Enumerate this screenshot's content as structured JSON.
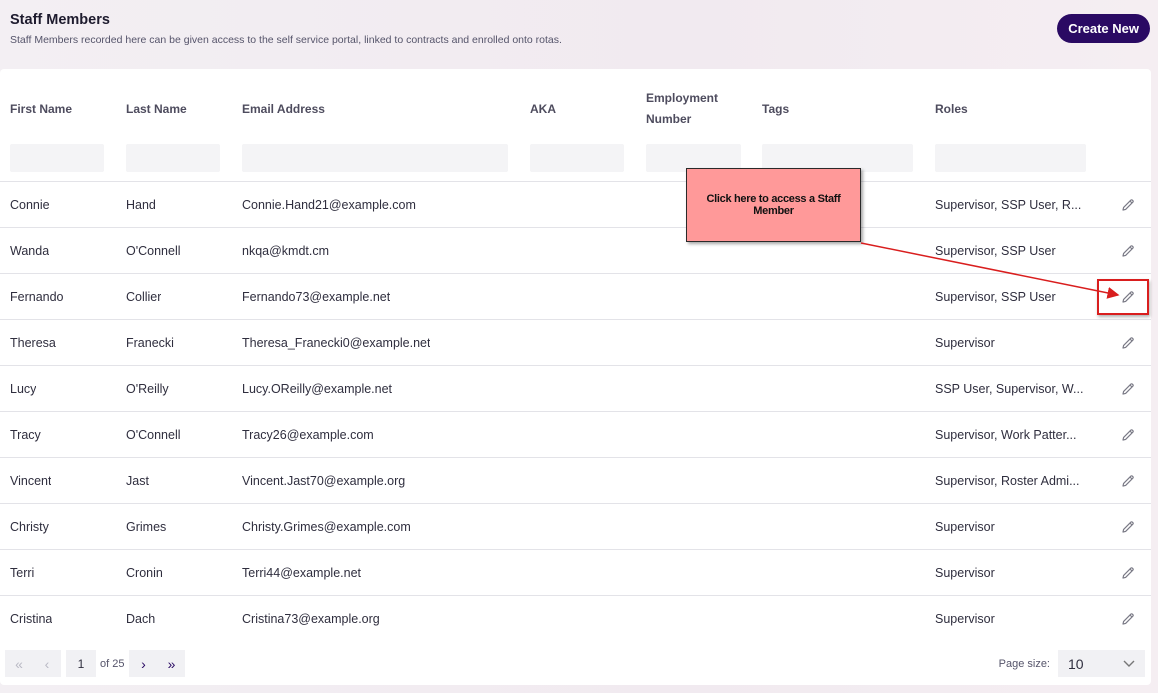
{
  "header": {
    "title": "Staff Members",
    "subtitle": "Staff Members recorded here can be given access to the self service portal, linked to contracts and enrolled onto rotas.",
    "create_button": "Create New"
  },
  "table": {
    "columns": [
      {
        "key": "first_name",
        "label": "First Name"
      },
      {
        "key": "last_name",
        "label": "Last Name"
      },
      {
        "key": "email",
        "label": "Email Address"
      },
      {
        "key": "aka",
        "label": "AKA"
      },
      {
        "key": "employment_number",
        "label": "Employment Number"
      },
      {
        "key": "tags",
        "label": "Tags"
      },
      {
        "key": "roles",
        "label": "Roles"
      }
    ],
    "rows": [
      {
        "first_name": "Connie",
        "last_name": "Hand",
        "email": "Connie.Hand21@example.com",
        "aka": "",
        "employment_number": "",
        "tags": "",
        "roles": "Supervisor, SSP User, R..."
      },
      {
        "first_name": "Wanda",
        "last_name": "O'Connell",
        "email": "nkqa@kmdt.cm",
        "aka": "",
        "employment_number": "",
        "tags": "",
        "roles": "Supervisor, SSP User"
      },
      {
        "first_name": "Fernando",
        "last_name": "Collier",
        "email": "Fernando73@example.net",
        "aka": "",
        "employment_number": "",
        "tags": "",
        "roles": "Supervisor, SSP User"
      },
      {
        "first_name": "Theresa",
        "last_name": "Franecki",
        "email": "Theresa_Franecki0@example.net",
        "aka": "",
        "employment_number": "",
        "tags": "",
        "roles": "Supervisor"
      },
      {
        "first_name": "Lucy",
        "last_name": "O'Reilly",
        "email": "Lucy.OReilly@example.net",
        "aka": "",
        "employment_number": "",
        "tags": "",
        "roles": "SSP User, Supervisor, W..."
      },
      {
        "first_name": "Tracy",
        "last_name": "O'Connell",
        "email": "Tracy26@example.com",
        "aka": "",
        "employment_number": "",
        "tags": "",
        "roles": "Supervisor, Work Patter..."
      },
      {
        "first_name": "Vincent",
        "last_name": "Jast",
        "email": "Vincent.Jast70@example.org",
        "aka": "",
        "employment_number": "",
        "tags": "",
        "roles": "Supervisor, Roster Admi..."
      },
      {
        "first_name": "Christy",
        "last_name": "Grimes",
        "email": "Christy.Grimes@example.com",
        "aka": "",
        "employment_number": "",
        "tags": "",
        "roles": "Supervisor"
      },
      {
        "first_name": "Terri",
        "last_name": "Cronin",
        "email": "Terri44@example.net",
        "aka": "",
        "employment_number": "",
        "tags": "",
        "roles": "Supervisor"
      },
      {
        "first_name": "Cristina",
        "last_name": "Dach",
        "email": "Cristina73@example.org",
        "aka": "",
        "employment_number": "",
        "tags": "",
        "roles": "Supervisor"
      }
    ],
    "row_action_icon": "pencil-icon"
  },
  "pagination": {
    "current_page": "1",
    "of_label": "of 25",
    "page_size_label": "Page size:",
    "page_size": "10",
    "icons": [
      "double-chevron-left-icon",
      "chevron-left-icon",
      "chevron-right-icon",
      "double-chevron-right-icon"
    ]
  },
  "annotation": {
    "callout_text": "Click here to access a Staff Member",
    "callout_color": "#ff9999",
    "highlight_color": "#d91e1e"
  },
  "colors": {
    "accent": "#2a0a63"
  }
}
